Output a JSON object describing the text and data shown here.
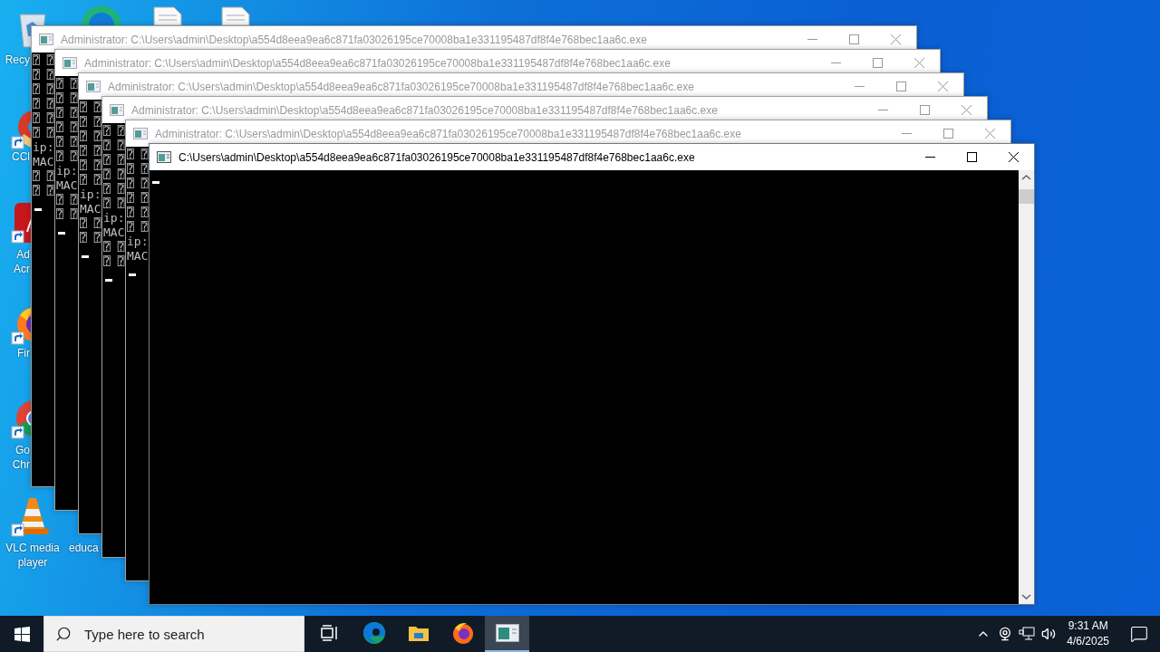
{
  "desktop_icons": [
    {
      "kind": "recycle-bin",
      "lines": [
        "Recy"
      ]
    },
    {
      "kind": "edge"
    },
    {
      "kind": "document"
    },
    {
      "kind": "document"
    },
    {
      "kind": "ccleaner",
      "lines": [
        "CCl"
      ]
    },
    {
      "kind": "acrobat",
      "lines": [
        "Ad",
        "Acr"
      ]
    },
    {
      "kind": "firefox",
      "lines": [
        "Fir"
      ]
    },
    {
      "kind": "chrome",
      "lines": [
        "Go",
        "Chr"
      ]
    },
    {
      "kind": "vlc",
      "lines": [
        "VLC media",
        "player"
      ]
    },
    {
      "kind": "hidden",
      "lines": [
        "educa"
      ]
    }
  ],
  "windows": [
    {
      "title": "Administrator: C:\\Users\\admin\\Desktop\\a554d8eea9ea6c871fa03026195ce70008ba1e331195487df8f4e768bec1aa6c.exe",
      "active": false,
      "lines": [
        "⍰ ⍰",
        "⍰ ⍰",
        "⍰ ⍰",
        "⍰ ⍰",
        "⍰ ⍰",
        "⍰ ⍰",
        "ip:",
        "MAC",
        "⍰ ⍰",
        "⍰ ⍰"
      ]
    },
    {
      "title": "Administrator: C:\\Users\\admin\\Desktop\\a554d8eea9ea6c871fa03026195ce70008ba1e331195487df8f4e768bec1aa6c.exe",
      "active": false,
      "lines": [
        "⍰ ⍰",
        "⍰ ⍰",
        "⍰ ⍰",
        "⍰ ⍰",
        "⍰ ⍰",
        "⍰ ⍰",
        "ip:",
        "MAC",
        "⍰ ⍰",
        "⍰ ⍰"
      ]
    },
    {
      "title": "Administrator: C:\\Users\\admin\\Desktop\\a554d8eea9ea6c871fa03026195ce70008ba1e331195487df8f4e768bec1aa6c.exe",
      "active": false,
      "lines": [
        "⍰ ⍰",
        "⍰ ⍰",
        "⍰ ⍰",
        "⍰ ⍰",
        "⍰ ⍰",
        "⍰ ⍰",
        "ip:",
        "MAC",
        "⍰ ⍰",
        "⍰ ⍰"
      ]
    },
    {
      "title": "Administrator: C:\\Users\\admin\\Desktop\\a554d8eea9ea6c871fa03026195ce70008ba1e331195487df8f4e768bec1aa6c.exe",
      "active": false,
      "lines": [
        "⍰ ⍰",
        "⍰ ⍰",
        "⍰ ⍰",
        "⍰ ⍰",
        "⍰ ⍰",
        "⍰ ⍰",
        "ip:",
        "MAC",
        "⍰ ⍰",
        "⍰ ⍰"
      ]
    },
    {
      "title": "Administrator: C:\\Users\\admin\\Desktop\\a554d8eea9ea6c871fa03026195ce70008ba1e331195487df8f4e768bec1aa6c.exe",
      "active": false,
      "lines": [
        "⍰ ⍰",
        "⍰ ⍰",
        "⍰ ⍰",
        "⍰ ⍰",
        "⍰ ⍰",
        "⍰ ⍰",
        "ip:",
        "MAC"
      ]
    },
    {
      "title": "C:\\Users\\admin\\Desktop\\a554d8eea9ea6c871fa03026195ce70008ba1e331195487df8f4e768bec1aa6c.exe",
      "active": true
    }
  ],
  "taskbar": {
    "search": {
      "placeholder": "Type here to search"
    },
    "apps": [
      {
        "kind": "task-view",
        "selected": false
      },
      {
        "kind": "edge",
        "selected": false
      },
      {
        "kind": "file-explorer",
        "selected": false
      },
      {
        "kind": "firefox",
        "selected": false
      },
      {
        "kind": "console",
        "selected": true
      }
    ],
    "clock": {
      "time": "9:31 AM",
      "date": "4/6/2025"
    }
  }
}
